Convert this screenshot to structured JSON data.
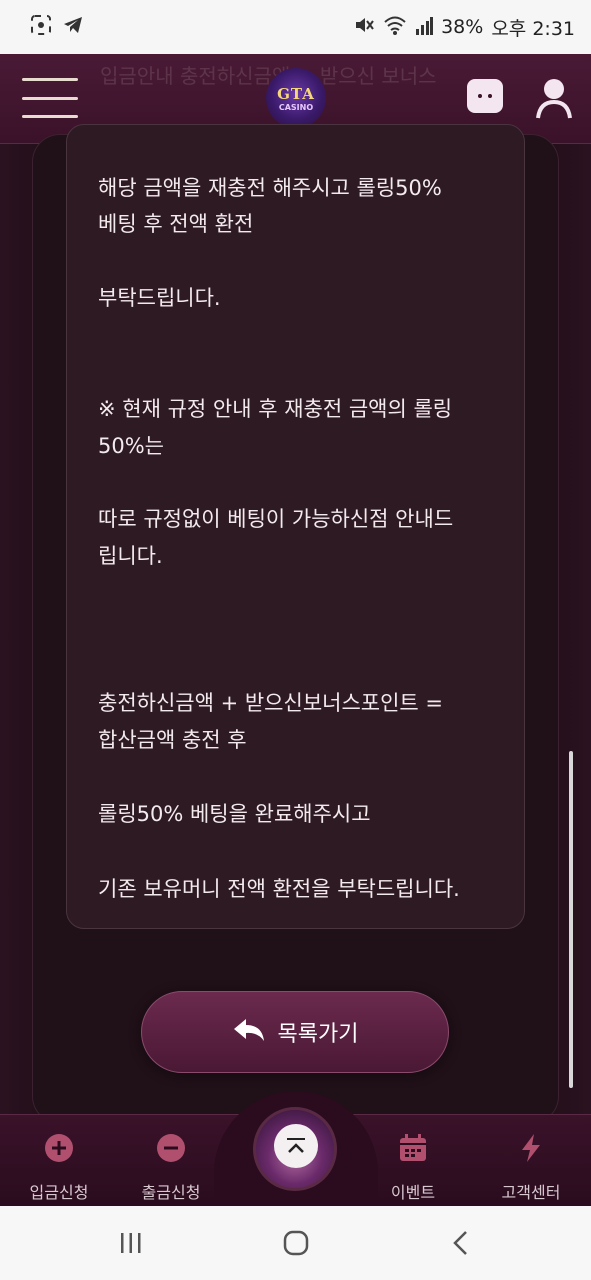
{
  "status_bar": {
    "battery": "38%",
    "time": "오후 2:31",
    "icons": [
      "screenshot-icon",
      "telegram-icon",
      "mute-icon",
      "wifi-icon",
      "signal-icon"
    ]
  },
  "header": {
    "logo_top": "GTA",
    "logo_bottom": "CASINO",
    "ghost_text": "입금안내 충전하신금액 + 받으신 보너스"
  },
  "message": {
    "lines": [
      "해당 금액을 재충전 해주시고 롤링50%",
      "베팅 후 전액 환전",
      "부탁드립니다.",
      "※ 현재 규정 안내 후 재충전 금액의 롤링",
      "50%는",
      "따로 규정없이 베팅이 가능하신점 안내드",
      "립니다.",
      "충전하신금액 + 받으신보너스포인트 =",
      "합산금액 충전 후",
      "롤링50% 베팅을 완료해주시고",
      "기존 보유머니 전액 환전을 부탁드립니다."
    ]
  },
  "back_button": {
    "label": "목록가기"
  },
  "bottom_nav": {
    "items": [
      {
        "label": "입금신청",
        "icon": "plus-circle-icon"
      },
      {
        "label": "출금신청",
        "icon": "minus-circle-icon"
      },
      {
        "label": "이벤트",
        "icon": "calendar-icon"
      },
      {
        "label": "고객센터",
        "icon": "lightning-icon"
      }
    ]
  },
  "colors": {
    "header_bg": "#4a1a35",
    "content_bg": "#1d0d16",
    "message_bg": "#2d1a22",
    "accent": "#6b2a4e"
  }
}
